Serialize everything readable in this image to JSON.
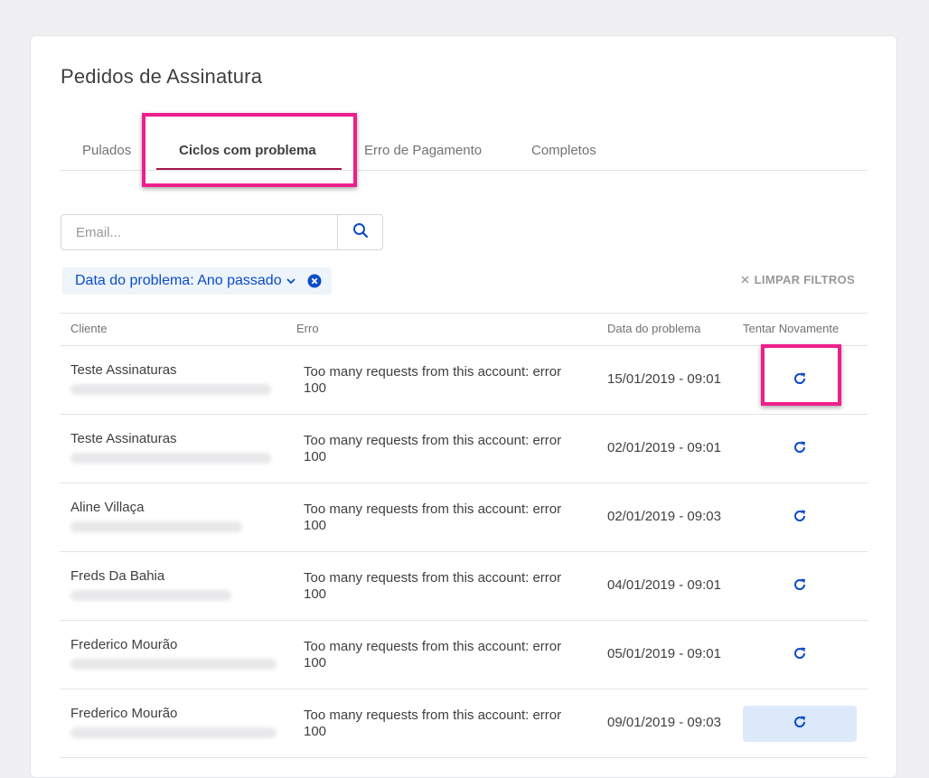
{
  "page": {
    "title": "Pedidos de Assinatura"
  },
  "tabs": [
    {
      "label": "Pulados"
    },
    {
      "label": "Ciclos com problema"
    },
    {
      "label": "Erro de Pagamento"
    },
    {
      "label": "Completos"
    }
  ],
  "search": {
    "placeholder": "Email..."
  },
  "filter": {
    "chip_label": "Data do problema: Ano passado",
    "clear_all": "LIMPAR FILTROS"
  },
  "table": {
    "headers": {
      "client": "Cliente",
      "error": "Erro",
      "date": "Data do problema",
      "retry": "Tentar Novamente"
    },
    "rows": [
      {
        "name": "Teste Assinaturas",
        "error": "Too many requests from this account: error 100",
        "date": "15/01/2019 - 09:01"
      },
      {
        "name": "Teste Assinaturas",
        "error": "Too many requests from this account: error 100",
        "date": "02/01/2019 - 09:01"
      },
      {
        "name": "Aline Villaça",
        "error": "Too many requests from this account: error 100",
        "date": "02/01/2019 - 09:03"
      },
      {
        "name": "Freds Da Bahia",
        "error": "Too many requests from this account: error 100",
        "date": "04/01/2019 - 09:01"
      },
      {
        "name": "Frederico Mourão",
        "error": "Too many requests from this account: error 100",
        "date": "05/01/2019 - 09:01"
      },
      {
        "name": "Frederico Mourão",
        "error": "Too many requests from this account: error 100",
        "date": "09/01/2019 - 09:03"
      }
    ]
  },
  "colors": {
    "accent_blue": "#0b4cc9",
    "active_tab_underline": "#a4134d",
    "highlight": "#ee1f8c",
    "chip_bg": "#edf4fa"
  },
  "icons": {
    "search": "search-icon",
    "retry": "refresh-icon",
    "chevron": "chevron-down-icon",
    "chip_clear": "close-circle-icon",
    "clear_all": "close-icon"
  }
}
